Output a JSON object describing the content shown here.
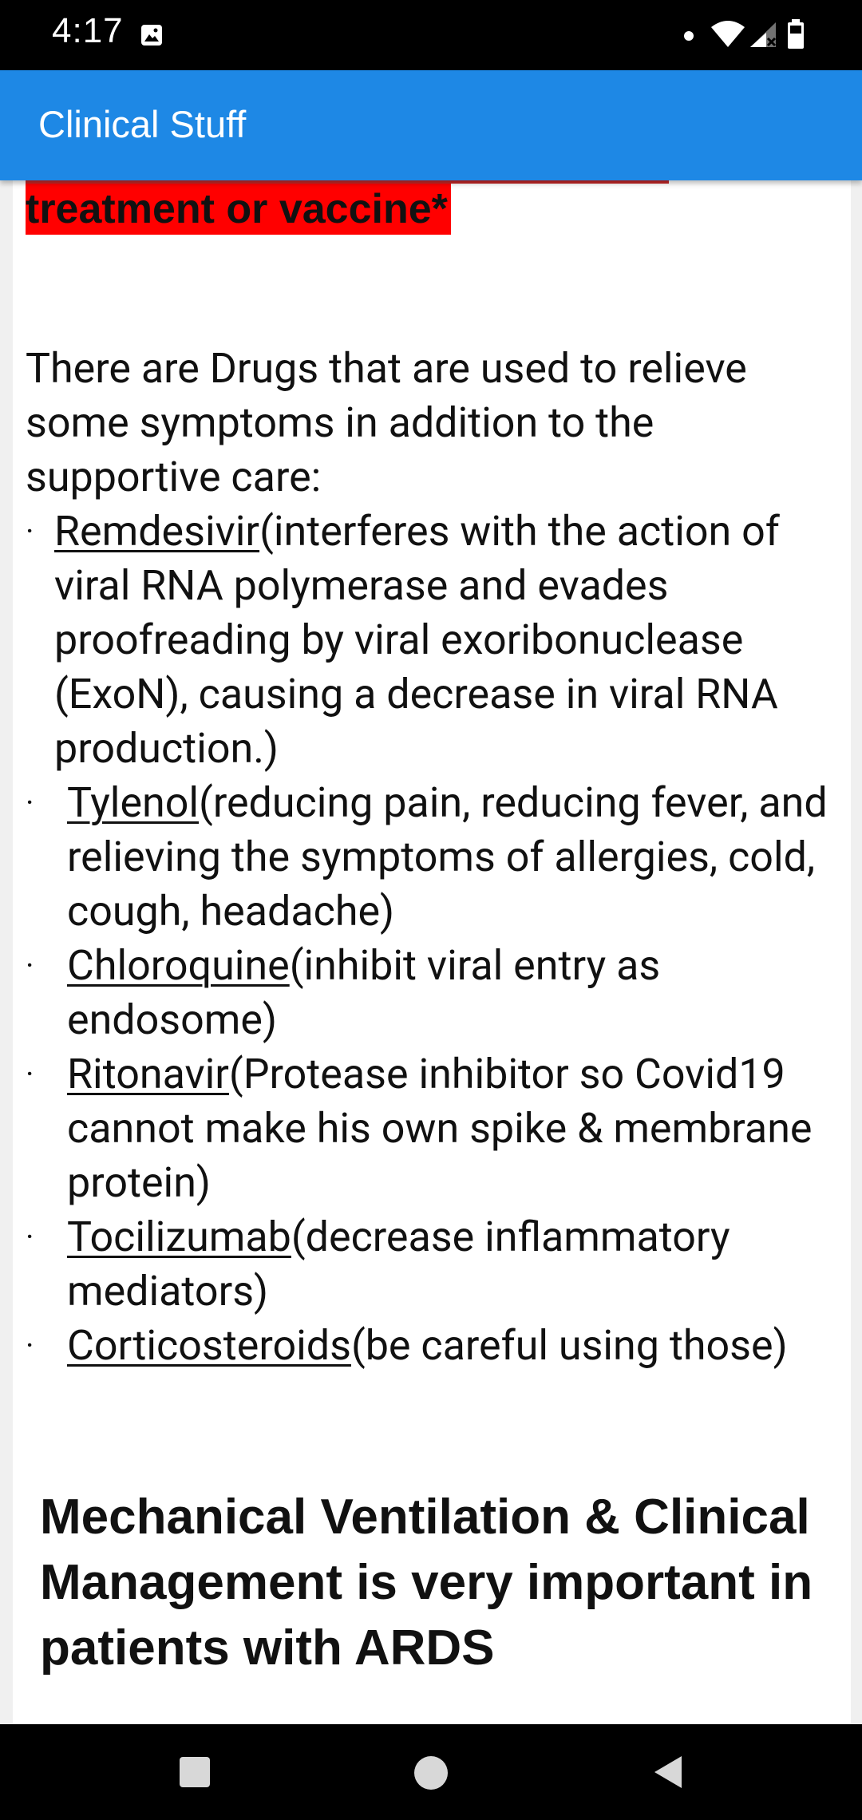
{
  "status_bar": {
    "time": "4:17",
    "icons": [
      "image-icon",
      "dot-icon",
      "wifi-icon",
      "signal-icon",
      "battery-icon"
    ]
  },
  "app_bar": {
    "title": "Clinical Stuff",
    "color": "#1e88e5"
  },
  "article": {
    "red_heading": "treatment or vaccine*",
    "intro": "There are Drugs that are used to relieve some symptoms in addition to the supportive care:",
    "drugs": [
      {
        "bullet": "·",
        "name": "Remdesivir",
        "description": "(interferes with the action of viral RNA polymerase and evades proofreading by viral exoribonuclease (ExoN), causing a decrease in viral RNA production.)"
      },
      {
        "bullet": "·",
        "name": "Tylenol",
        "description": "(reducing pain, reducing fever, and relieving the symptoms of allergies, cold, cough, headache)"
      },
      {
        "bullet": "·",
        "name": "Chloroquine",
        "description": "(inhibit viral entry as endosome)"
      },
      {
        "bullet": "·",
        "name": "Ritonavir",
        "description": "(Protease inhibitor so Covid19 cannot make his own spike & membrane protein)"
      },
      {
        "bullet": "·",
        "name": "Tocilizumab",
        "description": "(decrease inflammatory mediators)"
      },
      {
        "bullet": "·",
        "name": "Corticosteroids",
        "description": "(be careful using those)"
      }
    ],
    "section_heading": "Mechanical Ventilation & Clinical Management is very important in patients with ARDS"
  },
  "nav_bar": {
    "buttons": [
      "recent-apps-button",
      "home-button",
      "back-button"
    ]
  }
}
